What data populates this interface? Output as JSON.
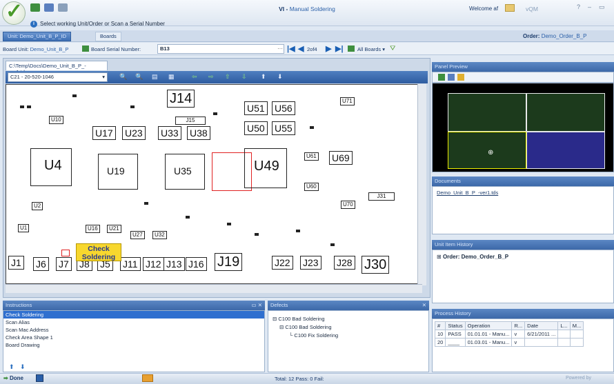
{
  "app": {
    "title_prefix": "VI -",
    "title": "Manual Soldering",
    "welcome": "Welcome af",
    "brand": "vQM",
    "help": "?",
    "minimize": "–",
    "restore": "▭"
  },
  "prompt": "Select working Unit/Order or Scan a Serial Number",
  "tabs": [
    {
      "label": "Unit: Demo_Unit_B_P_ID"
    },
    {
      "label": "Boards"
    }
  ],
  "order": {
    "label": "Order:",
    "value": "Demo_Order_B_P"
  },
  "board_bar": {
    "unit_label": "Board Unit:",
    "unit_value": "Demo_Unit_B_P",
    "serial_label": "Board Serial Number:",
    "serial_value": "B13",
    "page_indicator": "2of4",
    "all_boards": "All Boards"
  },
  "viewer": {
    "doc_tab": "C:\\Temp\\Docs\\Demo_Unit_B_P_-ver1.tds",
    "component": "C21",
    "component_part": "- 20-520-1046",
    "callout_line1": "Check",
    "callout_line2": "Soldering"
  },
  "refs": {
    "J14": "J14",
    "U51": "U51",
    "U56": "U56",
    "U50": "U50",
    "U55": "U55",
    "U17": "U17",
    "U23": "U23",
    "U33": "U33",
    "U38": "U38",
    "U4": "U4",
    "U19": "U19",
    "U35": "U35",
    "U49": "U49",
    "U69": "U69",
    "U10": "U10",
    "U71": "U71",
    "U61": "U61",
    "U60": "U60",
    "U70": "U70",
    "U2": "U2",
    "U1": "U1",
    "U16": "U16",
    "U21": "U21",
    "U27": "U27",
    "U32": "U32",
    "J1": "J1",
    "J6": "J6",
    "J7": "J7",
    "J8": "J8",
    "J5": "J5",
    "J11": "J11",
    "J12": "J12",
    "J13": "J13",
    "J16": "J16",
    "J19": "J19",
    "J22": "J22",
    "J23": "J23",
    "J28": "J28",
    "J30": "J30",
    "J31": "J31",
    "J15": "J15"
  },
  "panel_preview": {
    "title": "Panel Preview"
  },
  "documents": {
    "title": "Documents",
    "file": "Demo_Unit_B_P_-ver1.tds"
  },
  "unit_item_history": {
    "title": "Unit Item History",
    "order": "Order: Demo_Order_B_P"
  },
  "process_history": {
    "title": "Process History",
    "columns": [
      "#",
      "Status",
      "Operation",
      "R...",
      "Date",
      "L...",
      "M..."
    ],
    "rows": [
      [
        "10",
        "PASS",
        "01.01.01 - Manu...",
        "v",
        "6/21/2011 ...",
        "",
        ""
      ],
      [
        "20",
        "____",
        "01.03.01 - Manu...",
        "v",
        "",
        "",
        ""
      ]
    ]
  },
  "instructions": {
    "title": "Instructions",
    "items": [
      "Check Soldering",
      "Scan Alias",
      "Scan Mac Address",
      "Check Area Shape 1",
      "Board Drawing"
    ]
  },
  "defects": {
    "title": "Defects",
    "tree": [
      "C100 Bad Soldering",
      "C100 Bad Soldering",
      "C100 Fix Soldering"
    ]
  },
  "status": {
    "done": "Done",
    "totals": "Total: 12 Pass: 0 Fail:",
    "powered": "Powered by"
  },
  "colors": {
    "accent": "#3c68a8",
    "selection": "#2f6fcf",
    "callout": "#f7d72e",
    "highlight": "#e02020"
  }
}
